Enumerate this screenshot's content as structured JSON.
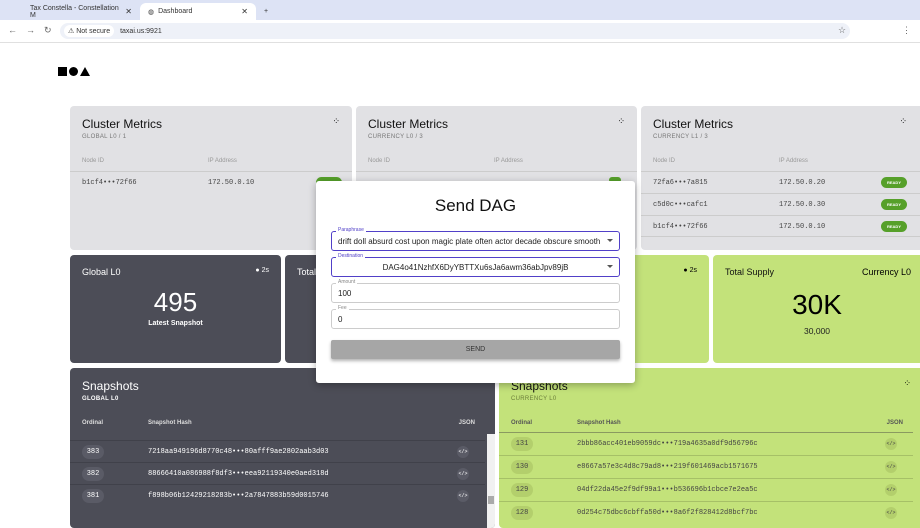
{
  "browser": {
    "tabs": [
      {
        "label": "Tax Constella - Constellation M"
      },
      {
        "label": "Dashboard"
      }
    ],
    "security": "Not secure",
    "url": "taxai.us:9921"
  },
  "clusters": [
    {
      "title": "Cluster Metrics",
      "subtitle": "GLOBAL L0 / 1",
      "col_node": "Node ID",
      "col_ip": "IP Address",
      "rows": [
        {
          "node": "b1cf4•••72f66",
          "ip": "172.50.0.10",
          "status": "READY"
        }
      ]
    },
    {
      "title": "Cluster Metrics",
      "subtitle": "CURRENCY L0 / 3",
      "col_node": "Node ID",
      "col_ip": "IP Address",
      "rows": []
    },
    {
      "title": "Cluster Metrics",
      "subtitle": "CURRENCY L1 / 3",
      "col_node": "Node ID",
      "col_ip": "IP Address",
      "rows": [
        {
          "node": "72fa6•••7a815",
          "ip": "172.50.0.20",
          "status": "READY"
        },
        {
          "node": "c5d0c•••cafc1",
          "ip": "172.50.0.30",
          "status": "READY"
        },
        {
          "node": "b1cf4•••72f66",
          "ip": "172.50.0.10",
          "status": "READY"
        }
      ]
    }
  ],
  "stats": {
    "global": {
      "label": "Global L0",
      "timer": "2s",
      "value": "495",
      "caption": "Latest Snapshot"
    },
    "total_dark": {
      "label": "Total"
    },
    "currency_timer": "2s",
    "supply": {
      "label": "Total Supply",
      "tag": "Currency L0",
      "value": "30K",
      "caption": "30,000"
    }
  },
  "snapshots": {
    "global": {
      "title": "Snapshots",
      "subtitle": "GLOBAL L0",
      "cols": [
        "Ordinal",
        "Snapshot Hash",
        "JSON"
      ],
      "rows": [
        {
          "ord": "383",
          "hash": "7218aa949196d8770c48•••80afff9ae2802aab3d03"
        },
        {
          "ord": "382",
          "hash": "88666410a086988f8df3•••eea92119340e0aed318d"
        },
        {
          "ord": "381",
          "hash": "f898b06b12429218283b•••2a7847883b59d0015746"
        }
      ]
    },
    "currency": {
      "title": "Snapshots",
      "subtitle": "CURRENCY L0",
      "cols": [
        "Ordinal",
        "Snapshot Hash",
        "JSON"
      ],
      "rows": [
        {
          "ord": "131",
          "hash": "2bbb86acc401eb9059dc•••719a4635a0df9d56796c"
        },
        {
          "ord": "130",
          "hash": "e8667a57e3c4d8c79ad8•••219f601469acb1571675"
        },
        {
          "ord": "129",
          "hash": "04df22da45e2f9df99a1•••b536696b1cbce7e2ea5c"
        },
        {
          "ord": "128",
          "hash": "0d254c75dbc6cbffa50d•••8a6f2f828412d8bcf7bc"
        }
      ]
    }
  },
  "modal": {
    "title": "Send DAG",
    "paraphrase_label": "Paraphrase",
    "paraphrase": "drift doll absurd cost upon magic plate often actor decade obscure smooth",
    "destination_label": "Destination",
    "destination": "DAG4o41NzhfX6DyYBTTXu6sJa6awm36abJpv89jB",
    "amount_label": "Amount",
    "amount": "100",
    "fee_label": "Fee",
    "fee": "0",
    "send": "SEND"
  }
}
